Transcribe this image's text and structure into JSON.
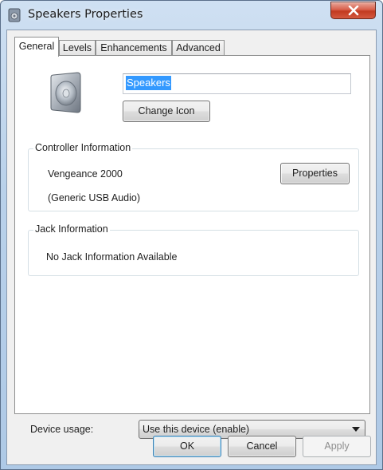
{
  "window": {
    "title": "Speakers Properties"
  },
  "tabs": [
    {
      "label": "General"
    },
    {
      "label": "Levels"
    },
    {
      "label": "Enhancements"
    },
    {
      "label": "Advanced"
    }
  ],
  "general": {
    "device_name": "Speakers",
    "change_icon_label": "Change Icon",
    "controller": {
      "legend": "Controller Information",
      "name": "Vengeance 2000",
      "type": "(Generic USB Audio)",
      "properties_label": "Properties"
    },
    "jack": {
      "legend": "Jack Information",
      "info": "No Jack Information Available"
    },
    "device_usage": {
      "label": "Device usage:",
      "selected": "Use this device (enable)"
    }
  },
  "footer": {
    "ok_label": "OK",
    "cancel_label": "Cancel",
    "apply_label": "Apply"
  },
  "icons": {
    "title": "speaker-icon",
    "device": "speaker-icon",
    "close": "close-icon",
    "dropdown": "chevron-down-icon"
  },
  "colors": {
    "selection": "#3399ff",
    "close_button": "#c94a30"
  }
}
